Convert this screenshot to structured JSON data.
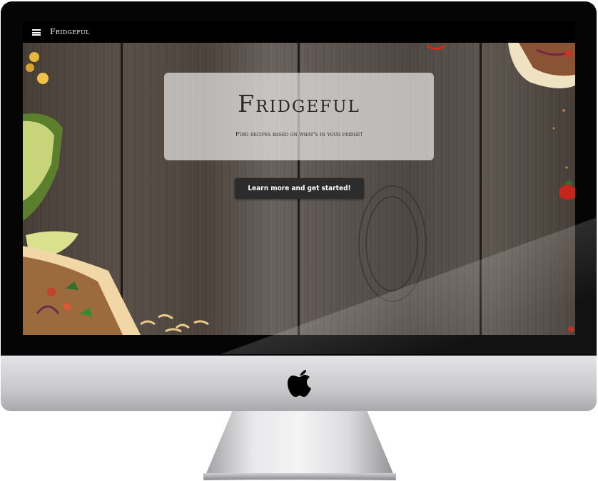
{
  "app": {
    "brand": "Fridgeful",
    "menu_icon": "hamburger-menu-icon"
  },
  "hero": {
    "title": "Fridgeful",
    "subtitle": "Find recipes based on what's in your fridge!",
    "cta_label": "Learn more and get started!"
  },
  "device": {
    "logo_icon": "apple-logo-icon"
  },
  "colors": {
    "navbar": "#000000",
    "card": "rgba(255,255,255,0.62)",
    "cta_bg": "#2c2c2c",
    "wood": "#5a5049"
  }
}
